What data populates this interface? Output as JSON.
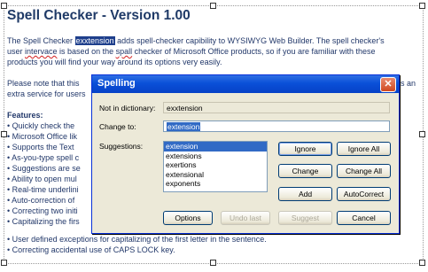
{
  "document": {
    "title": "Spell Checker - Version 1.00",
    "para1_pre": "The Spell Checker ",
    "para1_highlight": "exxtension",
    "para1_post": " adds spell-checker capibility to WYSIWYG Web Builder. The spell checker's",
    "para1_line2_a": "user ",
    "para1_line2_b": "intervace",
    "para1_line2_c": " is based on the ",
    "para1_line2_d": "spall",
    "para1_line2_e": " checker of Microsoft Office products, so if you are familiar with these",
    "para1_line3": "products you will find your way around its options very easily.",
    "para2_line1_a": "Please note that this",
    "para2_line1_b": "s an",
    "para2_line2": "extra service for users",
    "features_title": "Features:",
    "features": [
      "• Quickly check the",
      "• Microsoft Office lik",
      "• Supports the Text",
      "• As-you-type spell c",
      "• Suggestions are se",
      "• Ability to open mul",
      "• Real-time underlini",
      "• Auto-correction of",
      "• Correcting two initi",
      "• Capitalizing the firs",
      "• User defined exceptions for capitalizing of the first letter in the sentence.",
      "• Correcting accidental use of CAPS LOCK key."
    ]
  },
  "dialog": {
    "title": "Spelling",
    "close_glyph": "✕",
    "not_in_dictionary_label": "Not in dictionary:",
    "not_in_dictionary_value": "exxtension",
    "change_to_label": "Change to:",
    "change_to_value": "extension",
    "suggestions_label": "Suggestions:",
    "suggestions": [
      "extension",
      "extensions",
      "exertions",
      "extensional",
      "exponents"
    ],
    "buttons": {
      "ignore": "Ignore",
      "ignore_all": "Ignore All",
      "change": "Change",
      "change_all": "Change All",
      "add": "Add",
      "autocorrect": "AutoCorrect",
      "options": "Options",
      "undo_last": "Undo last",
      "suggest": "Suggest",
      "cancel": "Cancel"
    }
  },
  "colors": {
    "titlebar_blue": "#0a50d8",
    "selection_blue": "#316ac5",
    "doc_text": "#22386a",
    "dialog_face": "#ece9d8"
  }
}
